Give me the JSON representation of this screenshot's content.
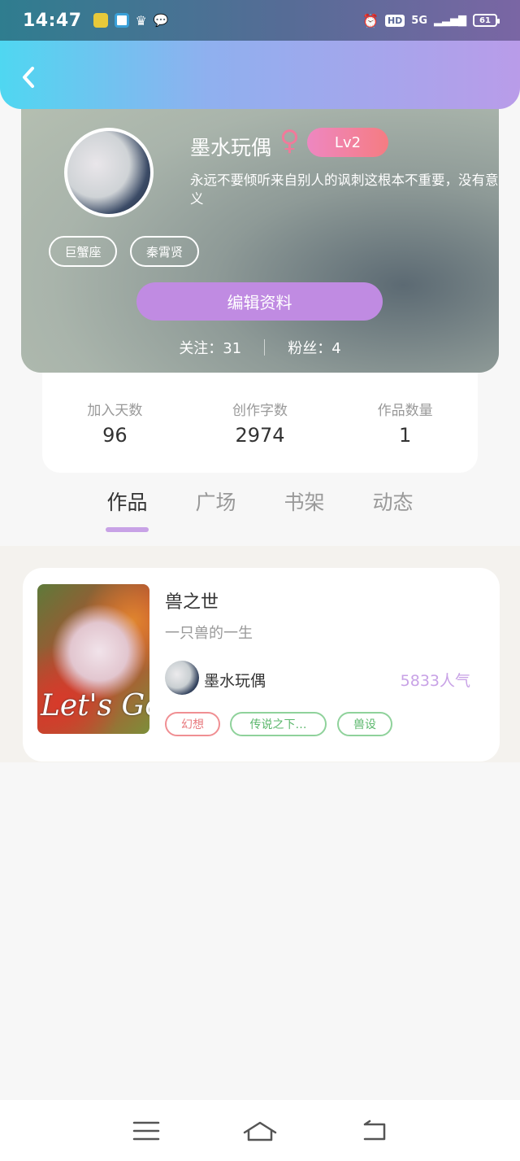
{
  "status": {
    "time": "14:47",
    "hd_label": "HD",
    "network": "5G",
    "battery": "61"
  },
  "profile": {
    "username": "墨水玩偶",
    "gender_symbol": "♀",
    "level": "Lv2",
    "signature": "永远不要倾听来自别人的讽刺这根本不重要，没有意义",
    "tags": [
      "巨蟹座",
      "秦霄贤"
    ],
    "edit_label": "编辑资料",
    "following": "关注：31",
    "followers": "粉丝：4"
  },
  "stats": [
    {
      "label": "加入天数",
      "value": "96"
    },
    {
      "label": "创作字数",
      "value": "2974"
    },
    {
      "label": "作品数量",
      "value": "1"
    }
  ],
  "tabs": [
    {
      "label": "作品",
      "active": true
    },
    {
      "label": "广场",
      "active": false
    },
    {
      "label": "书架",
      "active": false
    },
    {
      "label": "动态",
      "active": false
    }
  ],
  "works": [
    {
      "title": "兽之世",
      "description": "一只兽的一生",
      "cover_text": "Let's Go",
      "author": "墨水玩偶",
      "popularity": "5833人气",
      "tags": [
        "幻想",
        "传说之下…",
        "兽设"
      ]
    }
  ],
  "colors": {
    "accent": "#c08be2",
    "tab_underline": "#c8a2e6",
    "popularity": "#c8a2e6",
    "level_badge": "#f57c82"
  },
  "icons": {
    "back": "chevron-left-icon",
    "gender": "female-icon",
    "nav": [
      "menu-icon",
      "home-icon",
      "back-arrow-icon"
    ]
  }
}
